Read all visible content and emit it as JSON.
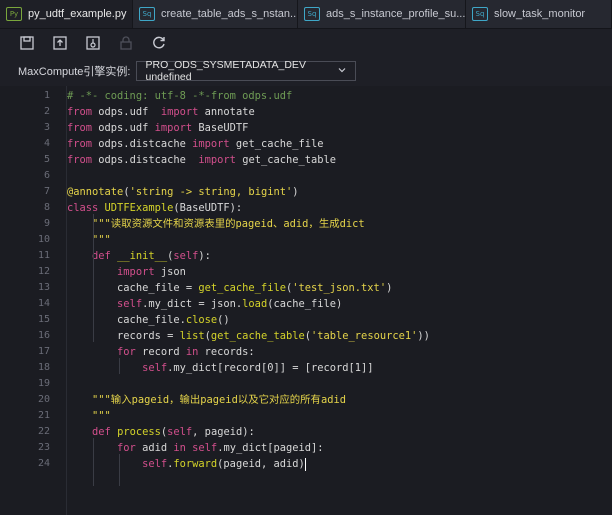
{
  "tabs": [
    {
      "label": "py_udtf_example.py",
      "icon": "Py",
      "active": true,
      "modified": true
    },
    {
      "label": "create_table_ads_s_nstan...",
      "icon": "Sq"
    },
    {
      "label": "ads_s_instance_profile_su...",
      "icon": "Sq"
    },
    {
      "label": "slow_task_monitor",
      "icon": "Sq"
    }
  ],
  "toolbar": {
    "icons": [
      "save-icon",
      "upload-icon",
      "run-icon",
      "lock-icon",
      "refresh-icon"
    ]
  },
  "instance": {
    "label": "MaxCompute引擎实例:",
    "value": "PRO_ODS_SYSMETADATA_DEV undefined"
  },
  "editor": {
    "lines": [
      {
        "n": "1",
        "t": [
          [
            "cm",
            "# -*- coding: utf-8 -*-from odps.udf"
          ]
        ]
      },
      {
        "n": "2",
        "t": [
          [
            "kw",
            "from"
          ],
          [
            "",
            " odps.udf  "
          ],
          [
            "kw",
            "import"
          ],
          [
            "",
            " annotate"
          ]
        ]
      },
      {
        "n": "3",
        "t": [
          [
            "kw",
            "from"
          ],
          [
            "",
            " odps.udf "
          ],
          [
            "kw",
            "import"
          ],
          [
            "",
            " BaseUDTF"
          ]
        ]
      },
      {
        "n": "4",
        "t": [
          [
            "kw",
            "from"
          ],
          [
            "",
            " odps.distcache "
          ],
          [
            "kw",
            "import"
          ],
          [
            "",
            " get_cache_file"
          ]
        ]
      },
      {
        "n": "5",
        "t": [
          [
            "kw",
            "from"
          ],
          [
            "",
            " odps.distcache  "
          ],
          [
            "kw",
            "import"
          ],
          [
            "",
            " get_cache_table"
          ]
        ]
      },
      {
        "n": "6",
        "t": []
      },
      {
        "n": "7",
        "t": [
          [
            "dec",
            "@annotate"
          ],
          [
            "",
            "("
          ],
          [
            "str",
            "'string -> string, bigint'"
          ],
          [
            "",
            ")"
          ]
        ]
      },
      {
        "n": "8",
        "t": [
          [
            "kw",
            "class"
          ],
          [
            "",
            " "
          ],
          [
            "fn",
            "UDTFExample"
          ],
          [
            "",
            "(BaseUDTF):"
          ]
        ]
      },
      {
        "n": "9",
        "t": [
          [
            "",
            "    "
          ],
          [
            "str",
            "\"\"\"读取资源文件和资源表里的pageid、adid，生成dict"
          ]
        ]
      },
      {
        "n": "10",
        "t": [
          [
            "",
            "    "
          ],
          [
            "str",
            "\"\"\""
          ]
        ]
      },
      {
        "n": "11",
        "t": [
          [
            "",
            "    "
          ],
          [
            "kw",
            "def"
          ],
          [
            "",
            " "
          ],
          [
            "fn",
            "__init__"
          ],
          [
            "",
            "("
          ],
          [
            "self",
            "self"
          ],
          [
            "",
            "):"
          ]
        ]
      },
      {
        "n": "12",
        "t": [
          [
            "",
            "        "
          ],
          [
            "kw",
            "import"
          ],
          [
            "",
            " json"
          ]
        ]
      },
      {
        "n": "13",
        "t": [
          [
            "",
            "        cache_file = "
          ],
          [
            "fn",
            "get_cache_file"
          ],
          [
            "",
            "("
          ],
          [
            "str",
            "'test_json.txt'"
          ],
          [
            "",
            ")"
          ]
        ]
      },
      {
        "n": "14",
        "t": [
          [
            "",
            "        "
          ],
          [
            "self",
            "self"
          ],
          [
            "",
            ".my_dict = json."
          ],
          [
            "fn",
            "load"
          ],
          [
            "",
            "(cache_file)"
          ]
        ]
      },
      {
        "n": "15",
        "t": [
          [
            "",
            "        cache_file."
          ],
          [
            "fn",
            "close"
          ],
          [
            "",
            "()"
          ]
        ]
      },
      {
        "n": "16",
        "t": [
          [
            "",
            "        records = "
          ],
          [
            "fn",
            "list"
          ],
          [
            "",
            "("
          ],
          [
            "fn",
            "get_cache_table"
          ],
          [
            "",
            "("
          ],
          [
            "str",
            "'table_resource1'"
          ],
          [
            "",
            "))"
          ]
        ]
      },
      {
        "n": "17",
        "t": [
          [
            "",
            "        "
          ],
          [
            "kw",
            "for"
          ],
          [
            "",
            " record "
          ],
          [
            "kw",
            "in"
          ],
          [
            "",
            " records:"
          ]
        ]
      },
      {
        "n": "18",
        "t": [
          [
            "",
            "            "
          ],
          [
            "self",
            "self"
          ],
          [
            "",
            ".my_dict[record[0]] = [record[1]]"
          ]
        ]
      },
      {
        "n": "19",
        "t": []
      },
      {
        "n": "20",
        "t": [
          [
            "",
            "    "
          ],
          [
            "str",
            "\"\"\"输入pageid，输出pageid以及它对应的所有adid"
          ]
        ]
      },
      {
        "n": "21",
        "t": [
          [
            "",
            "    "
          ],
          [
            "str",
            "\"\"\""
          ]
        ]
      },
      {
        "n": "22",
        "t": [
          [
            "",
            "    "
          ],
          [
            "kw",
            "def"
          ],
          [
            "",
            " "
          ],
          [
            "fn",
            "process"
          ],
          [
            "",
            "("
          ],
          [
            "self",
            "self"
          ],
          [
            "",
            ", pageid):"
          ]
        ]
      },
      {
        "n": "23",
        "t": [
          [
            "",
            "        "
          ],
          [
            "kw",
            "for"
          ],
          [
            "",
            " adid "
          ],
          [
            "kw",
            "in"
          ],
          [
            "",
            " "
          ],
          [
            "self",
            "self"
          ],
          [
            "",
            ".my_dict[pageid]:"
          ]
        ]
      },
      {
        "n": "24",
        "t": [
          [
            "",
            "            "
          ],
          [
            "self",
            "self"
          ],
          [
            "",
            "."
          ],
          [
            "fn",
            "forward"
          ],
          [
            "",
            "(pageid, adid)"
          ]
        ]
      }
    ]
  }
}
